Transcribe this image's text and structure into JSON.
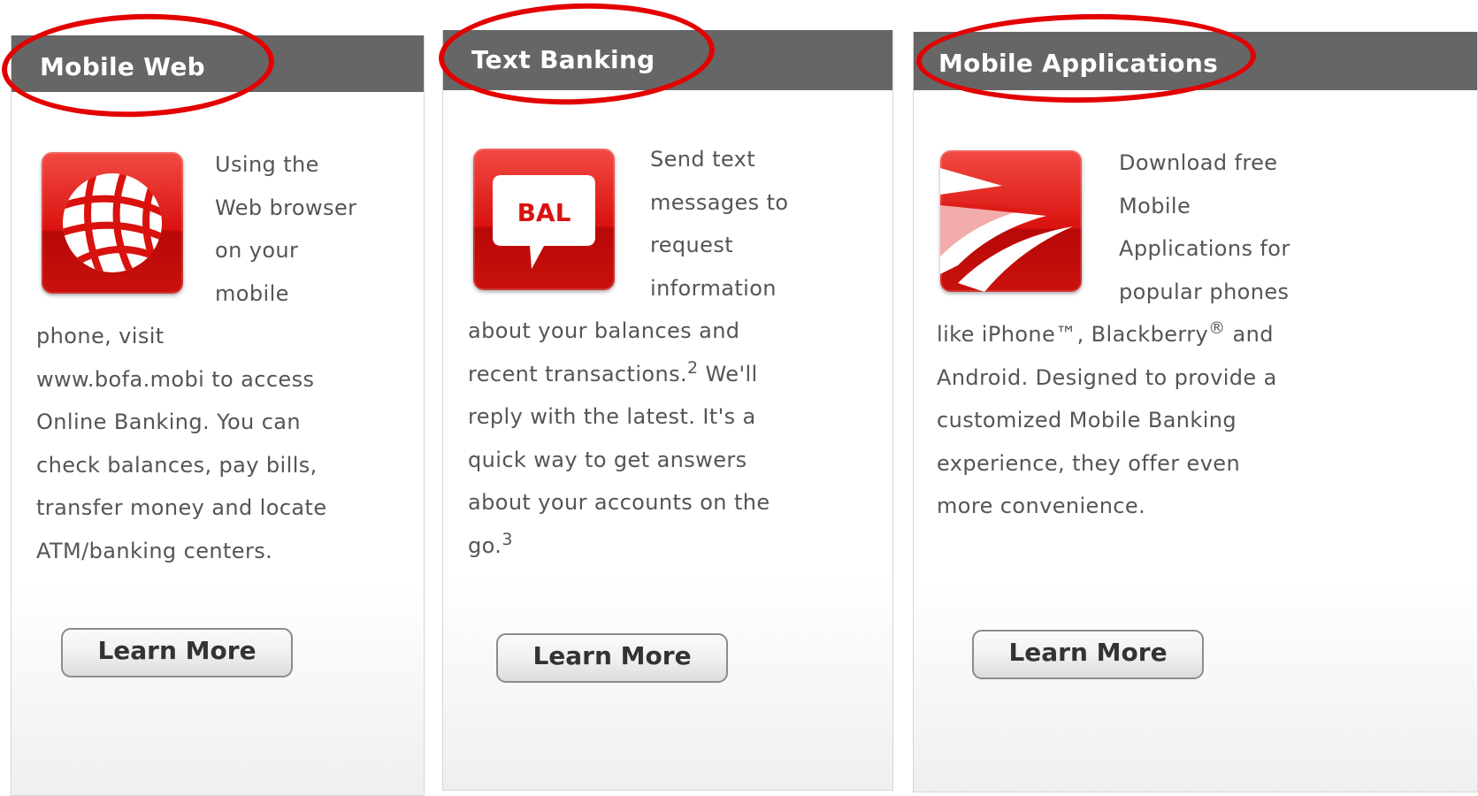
{
  "cards": [
    {
      "title": "Mobile Web",
      "icon": "globe-icon",
      "wrap_lines": [
        "Using the",
        "Web browser",
        "on your",
        "mobile"
      ],
      "full_lines": [
        "phone, visit",
        "www.bofa.mobi to access",
        "Online Banking. You can",
        "check balances, pay bills,",
        "transfer money and locate",
        "ATM/banking centers."
      ],
      "button_label": "Learn More"
    },
    {
      "title": "Text Banking",
      "icon": "speech-bubble-icon",
      "icon_text": "BAL",
      "wrap_lines": [
        "Send text",
        "messages to",
        "request",
        "information"
      ],
      "full_lines": [
        "about your balances and",
        "recent transactions.",
        "reply with the latest. It's a",
        "quick way to get answers",
        "about your accounts on the",
        "go."
      ],
      "footnote_2": "2",
      "after_footnote_2": " We'll",
      "footnote_3": "3",
      "button_label": "Learn More"
    },
    {
      "title": "Mobile Applications",
      "icon": "flag-logo-icon",
      "wrap_lines": [
        "Download free",
        "Mobile",
        "Applications for",
        "popular phones"
      ],
      "full_lines": [
        "like iPhone™, Blackberry",
        "Android. Designed to provide a",
        "customized Mobile Banking",
        "experience, they offer even",
        "more convenience."
      ],
      "registered_mark": "®",
      "after_registered": " and",
      "button_label": "Learn More"
    }
  ],
  "colors": {
    "header_bg": "#666666",
    "highlight": "#e30000",
    "icon_red": "#d9120e"
  }
}
